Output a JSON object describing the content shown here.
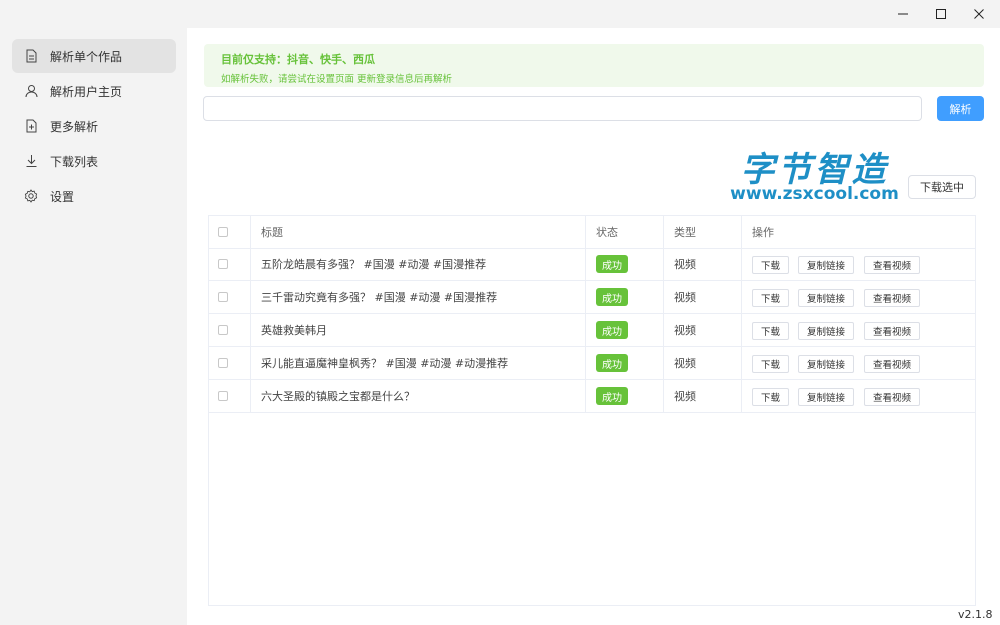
{
  "window": {
    "minimize_icon": "minimize-icon",
    "maximize_icon": "maximize-icon",
    "close_icon": "close-icon"
  },
  "sidebar": {
    "items": [
      {
        "label": "解析单个作品",
        "icon": "document-icon",
        "active": true
      },
      {
        "label": "解析用户主页",
        "icon": "user-icon",
        "active": false
      },
      {
        "label": "更多解析",
        "icon": "add-file-icon",
        "active": false
      },
      {
        "label": "下载列表",
        "icon": "download-icon",
        "active": false
      },
      {
        "label": "设置",
        "icon": "gear-icon",
        "active": false
      }
    ]
  },
  "notice": {
    "title": "目前仅支持：抖音、快手、西瓜",
    "subtitle": "如解析失败，请尝试在设置页面 更新登录信息后再解析"
  },
  "url_input": {
    "value": "",
    "placeholder": ""
  },
  "parse_button": "解析",
  "logo": {
    "cn": "字节智造",
    "en": "www.zsxcool.com"
  },
  "download_selected_button": "下载选中",
  "table": {
    "headers": {
      "title": "标题",
      "status": "状态",
      "type": "类型",
      "actions": "操作"
    },
    "rows": [
      {
        "title": "五阶龙皓晨有多强？ #国漫 #动漫 #国漫推荐",
        "status": "成功",
        "type": "视频"
      },
      {
        "title": "三千雷动究竟有多强？ #国漫 #动漫 #国漫推荐",
        "status": "成功",
        "type": "视频"
      },
      {
        "title": "英雄救美韩月",
        "status": "成功",
        "type": "视频"
      },
      {
        "title": "采儿能直逼魔神皇枫秀？ #国漫 #动漫 #动漫推荐",
        "status": "成功",
        "type": "视频"
      },
      {
        "title": "六大圣殿的镇殿之宝都是什么？",
        "status": "成功",
        "type": "视频"
      }
    ],
    "action_labels": {
      "download": "下载",
      "copy_link": "复制链接",
      "view_video": "查看视频"
    }
  },
  "version": "v2.1.8",
  "colors": {
    "accent": "#409eff",
    "success": "#67c23a",
    "notice_bg": "#f0f9eb"
  }
}
